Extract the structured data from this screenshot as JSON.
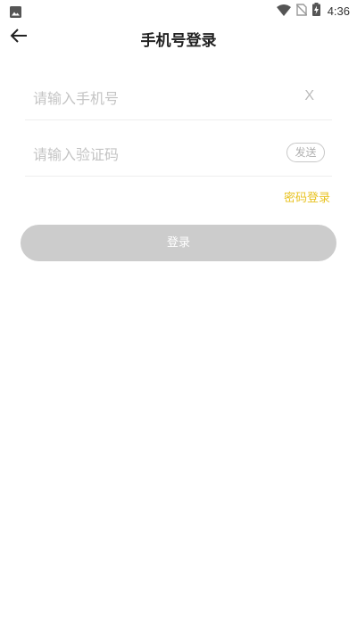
{
  "status_bar": {
    "time": "4:36",
    "icons": [
      "image-icon",
      "wifi-icon",
      "no-sim-icon",
      "battery-charging-icon"
    ]
  },
  "header": {
    "title": "手机号登录",
    "back_icon": "arrow-left-icon"
  },
  "form": {
    "phone": {
      "placeholder": "请输入手机号",
      "value": "",
      "clear_label": "X"
    },
    "code": {
      "placeholder": "请输入验证码",
      "value": "",
      "send_label": "发送"
    },
    "password_login_link": "密码登录",
    "submit_label": "登录"
  },
  "colors": {
    "accent": "#e8c220",
    "button_disabled": "#cccccc",
    "placeholder": "#c4c4c4",
    "divider": "#eeeeee"
  }
}
